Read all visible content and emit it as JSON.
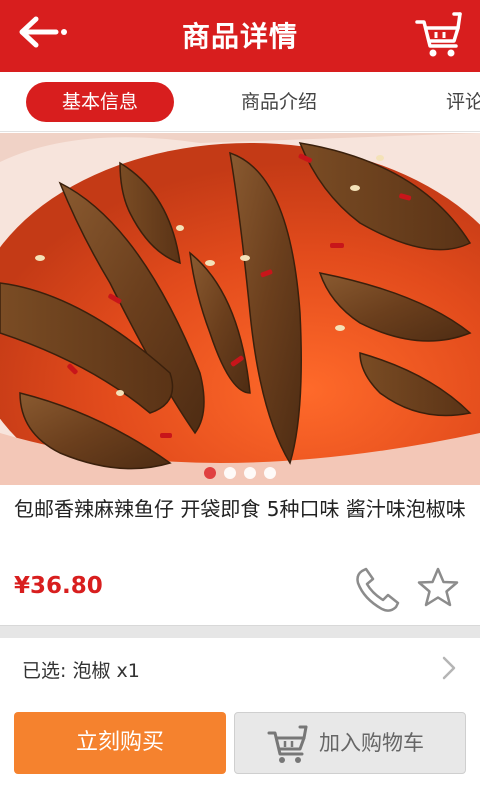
{
  "header": {
    "title": "商品详情",
    "back_icon": "back-arrow-icon",
    "cart_icon": "shopping-cart-icon"
  },
  "tabs": [
    {
      "label": "基本信息",
      "active": true
    },
    {
      "label": "商品介绍",
      "active": false
    },
    {
      "label": "评论",
      "active": false
    }
  ],
  "carousel": {
    "image": "spicy-fish-snack-photo",
    "slide_count": 4,
    "active_index": 0
  },
  "product": {
    "name": "包邮香辣麻辣鱼仔 开袋即食 5种口味 酱汁味泡椒味",
    "price": "¥36.80"
  },
  "actions": {
    "phone_icon": "phone-icon",
    "favorite_icon": "star-icon"
  },
  "selection": {
    "text": "已选: 泡椒 x1"
  },
  "bottom": {
    "buy_label": "立刻购买",
    "add_cart_label": "加入购物车"
  },
  "colors": {
    "brand_red": "#d81e1e",
    "buy_orange": "#f5822e",
    "price_red": "#d81e1e"
  }
}
